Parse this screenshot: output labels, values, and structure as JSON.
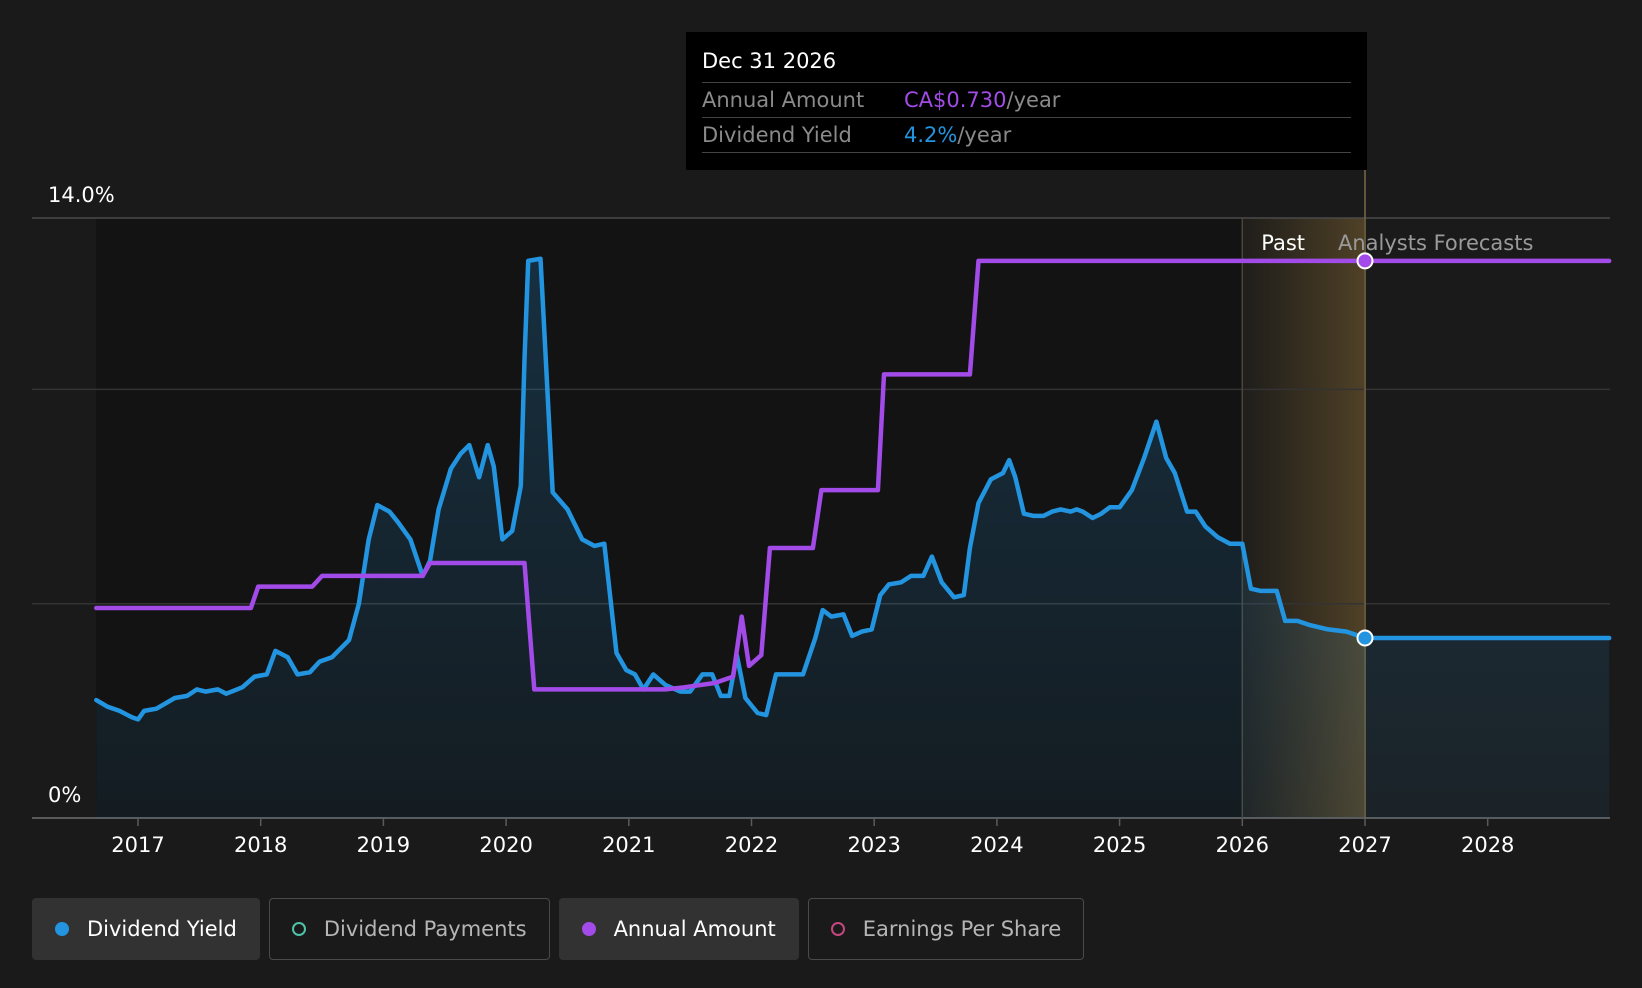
{
  "chart_data": {
    "type": "line",
    "x_ticks": [
      "2017",
      "2018",
      "2019",
      "2020",
      "2021",
      "2022",
      "2023",
      "2024",
      "2025",
      "2026",
      "2027",
      "2028"
    ],
    "y_ticks": [
      "14.0%",
      "0%"
    ],
    "ylim": [
      0,
      14
    ],
    "y_gridlines": [
      0,
      5,
      10,
      14
    ],
    "region_labels": {
      "past": "Past",
      "forecast": "Analysts Forecasts"
    },
    "past_boundary": 2026.0,
    "highlight_end": 2027.0,
    "series": [
      {
        "name": "Dividend Yield",
        "color": "#2394df",
        "axis": "yield_percent",
        "points": [
          [
            2016.66,
            2.75
          ],
          [
            2016.75,
            2.6
          ],
          [
            2016.85,
            2.5
          ],
          [
            2016.95,
            2.35
          ],
          [
            2017.0,
            2.3
          ],
          [
            2017.05,
            2.5
          ],
          [
            2017.15,
            2.55
          ],
          [
            2017.3,
            2.8
          ],
          [
            2017.4,
            2.85
          ],
          [
            2017.48,
            3.0
          ],
          [
            2017.55,
            2.95
          ],
          [
            2017.65,
            3.0
          ],
          [
            2017.72,
            2.9
          ],
          [
            2017.85,
            3.05
          ],
          [
            2017.95,
            3.3
          ],
          [
            2018.05,
            3.35
          ],
          [
            2018.12,
            3.9
          ],
          [
            2018.22,
            3.75
          ],
          [
            2018.3,
            3.35
          ],
          [
            2018.4,
            3.4
          ],
          [
            2018.48,
            3.65
          ],
          [
            2018.58,
            3.75
          ],
          [
            2018.72,
            4.15
          ],
          [
            2018.8,
            5.0
          ],
          [
            2018.88,
            6.5
          ],
          [
            2018.95,
            7.3
          ],
          [
            2019.05,
            7.15
          ],
          [
            2019.12,
            6.9
          ],
          [
            2019.22,
            6.5
          ],
          [
            2019.32,
            5.65
          ],
          [
            2019.38,
            6.0
          ],
          [
            2019.45,
            7.2
          ],
          [
            2019.55,
            8.15
          ],
          [
            2019.63,
            8.5
          ],
          [
            2019.7,
            8.7
          ],
          [
            2019.78,
            7.95
          ],
          [
            2019.85,
            8.7
          ],
          [
            2019.9,
            8.2
          ],
          [
            2019.97,
            6.5
          ],
          [
            2020.05,
            6.7
          ],
          [
            2020.12,
            7.75
          ],
          [
            2020.15,
            10.7
          ],
          [
            2020.18,
            13.0
          ],
          [
            2020.28,
            13.05
          ],
          [
            2020.3,
            12.0
          ],
          [
            2020.38,
            7.6
          ],
          [
            2020.5,
            7.2
          ],
          [
            2020.62,
            6.5
          ],
          [
            2020.72,
            6.35
          ],
          [
            2020.8,
            6.4
          ],
          [
            2020.9,
            3.85
          ],
          [
            2020.98,
            3.45
          ],
          [
            2021.05,
            3.35
          ],
          [
            2021.12,
            3.0
          ],
          [
            2021.2,
            3.35
          ],
          [
            2021.3,
            3.1
          ],
          [
            2021.42,
            2.95
          ],
          [
            2021.5,
            2.95
          ],
          [
            2021.6,
            3.35
          ],
          [
            2021.68,
            3.35
          ],
          [
            2021.75,
            2.85
          ],
          [
            2021.82,
            2.85
          ],
          [
            2021.88,
            3.8
          ],
          [
            2021.95,
            2.8
          ],
          [
            2022.05,
            2.45
          ],
          [
            2022.12,
            2.4
          ],
          [
            2022.2,
            3.35
          ],
          [
            2022.3,
            3.35
          ],
          [
            2022.42,
            3.35
          ],
          [
            2022.52,
            4.2
          ],
          [
            2022.58,
            4.85
          ],
          [
            2022.65,
            4.7
          ],
          [
            2022.75,
            4.75
          ],
          [
            2022.82,
            4.25
          ],
          [
            2022.9,
            4.35
          ],
          [
            2022.98,
            4.4
          ],
          [
            2023.05,
            5.2
          ],
          [
            2023.12,
            5.45
          ],
          [
            2023.22,
            5.5
          ],
          [
            2023.3,
            5.65
          ],
          [
            2023.4,
            5.65
          ],
          [
            2023.47,
            6.1
          ],
          [
            2023.55,
            5.5
          ],
          [
            2023.65,
            5.15
          ],
          [
            2023.73,
            5.2
          ],
          [
            2023.78,
            6.3
          ],
          [
            2023.85,
            7.35
          ],
          [
            2023.95,
            7.9
          ],
          [
            2024.05,
            8.05
          ],
          [
            2024.1,
            8.35
          ],
          [
            2024.15,
            7.95
          ],
          [
            2024.22,
            7.1
          ],
          [
            2024.3,
            7.05
          ],
          [
            2024.38,
            7.05
          ],
          [
            2024.45,
            7.15
          ],
          [
            2024.52,
            7.2
          ],
          [
            2024.6,
            7.15
          ],
          [
            2024.65,
            7.2
          ],
          [
            2024.7,
            7.15
          ],
          [
            2024.78,
            7.0
          ],
          [
            2024.85,
            7.1
          ],
          [
            2024.92,
            7.25
          ],
          [
            2025.0,
            7.25
          ],
          [
            2025.1,
            7.65
          ],
          [
            2025.2,
            8.4
          ],
          [
            2025.3,
            9.25
          ],
          [
            2025.38,
            8.4
          ],
          [
            2025.45,
            8.05
          ],
          [
            2025.55,
            7.15
          ],
          [
            2025.62,
            7.15
          ],
          [
            2025.7,
            6.8
          ],
          [
            2025.8,
            6.55
          ],
          [
            2025.9,
            6.4
          ],
          [
            2026.0,
            6.4
          ],
          [
            2026.07,
            5.35
          ],
          [
            2026.15,
            5.3
          ],
          [
            2026.28,
            5.3
          ],
          [
            2026.35,
            4.6
          ],
          [
            2026.45,
            4.6
          ],
          [
            2026.55,
            4.5
          ],
          [
            2026.7,
            4.4
          ],
          [
            2026.85,
            4.35
          ],
          [
            2027.0,
            4.2
          ],
          [
            2028.99,
            4.2
          ]
        ]
      },
      {
        "name": "Annual Amount",
        "color": "#a24be8",
        "axis": "amount",
        "points": [
          [
            2016.66,
            4.9
          ],
          [
            2017.92,
            4.9
          ],
          [
            2017.98,
            5.4
          ],
          [
            2018.42,
            5.4
          ],
          [
            2018.5,
            5.65
          ],
          [
            2019.32,
            5.65
          ],
          [
            2019.38,
            5.95
          ],
          [
            2020.15,
            5.95
          ],
          [
            2020.23,
            3.0
          ],
          [
            2021.3,
            3.0
          ],
          [
            2021.45,
            3.05
          ],
          [
            2021.7,
            3.15
          ],
          [
            2021.85,
            3.3
          ],
          [
            2021.92,
            4.7
          ],
          [
            2021.98,
            3.55
          ],
          [
            2022.08,
            3.8
          ],
          [
            2022.15,
            6.3
          ],
          [
            2022.5,
            6.3
          ],
          [
            2022.57,
            7.65
          ],
          [
            2023.03,
            7.65
          ],
          [
            2023.08,
            10.35
          ],
          [
            2023.78,
            10.35
          ],
          [
            2023.85,
            13.0
          ],
          [
            2028.99,
            13.0
          ]
        ]
      }
    ],
    "markers": [
      {
        "series": "Annual Amount",
        "x": 2027.0,
        "y": 13.0
      },
      {
        "series": "Dividend Yield",
        "x": 2027.0,
        "y": 4.2
      }
    ]
  },
  "tooltip": {
    "date": "Dec 31 2026",
    "rows": [
      {
        "label": "Annual Amount",
        "value": "CA$0.730",
        "unit": "/year",
        "color": "#a24be8"
      },
      {
        "label": "Dividend Yield",
        "value": "4.2%",
        "unit": "/year",
        "color": "#2394df"
      }
    ]
  },
  "legend": [
    {
      "label": "Dividend Yield",
      "color": "#2394df",
      "active": true
    },
    {
      "label": "Dividend Payments",
      "color": "#4fc2a8",
      "active": false
    },
    {
      "label": "Annual Amount",
      "color": "#a24be8",
      "active": true
    },
    {
      "label": "Earnings Per Share",
      "color": "#c4477f",
      "active": false
    }
  ]
}
